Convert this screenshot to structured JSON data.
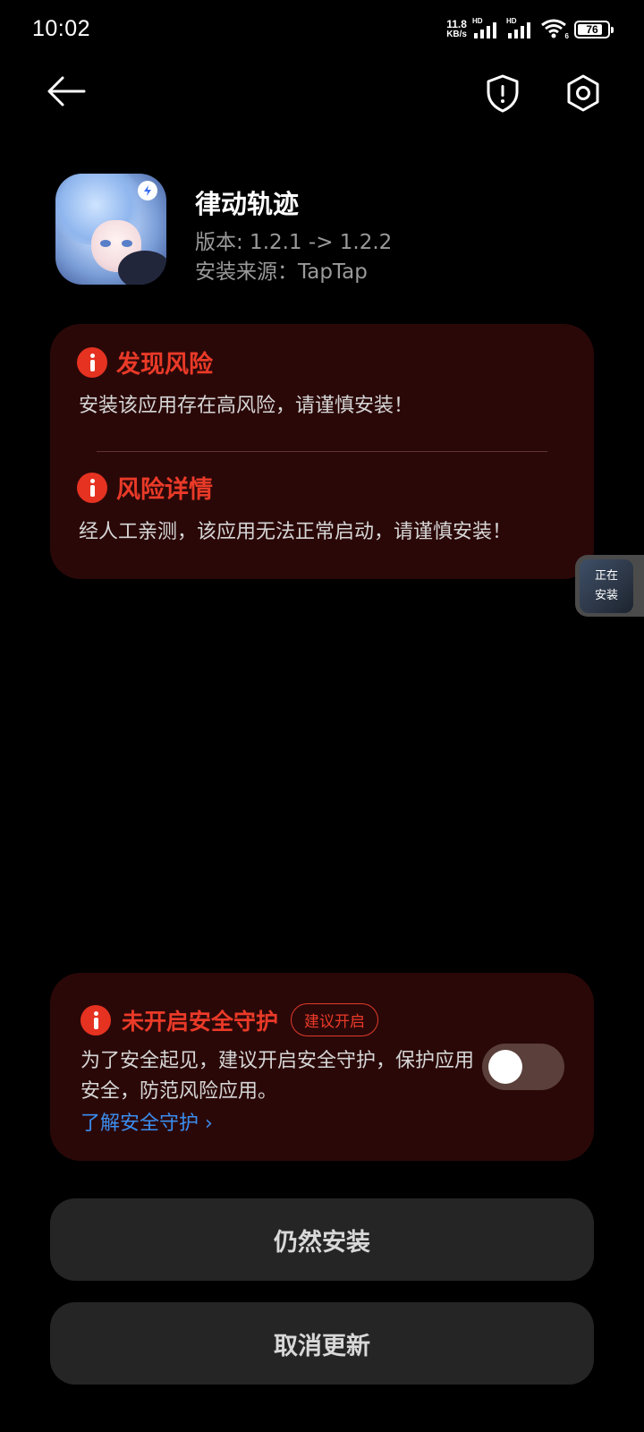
{
  "status_bar": {
    "time": "10:02",
    "net_speed_value": "11.8",
    "net_speed_unit": "KB/s",
    "sim1_label": "HD",
    "sim2_label": "HD",
    "wifi_label": "6",
    "battery": "76"
  },
  "nav": {
    "back_icon": "arrow-left-icon",
    "shield_icon": "shield-alert-icon",
    "settings_icon": "hexagon-gear-icon"
  },
  "app": {
    "name": "律动轨迹",
    "version": "版本: 1.2.1 -> 1.2.2",
    "source": "安装来源：TapTap"
  },
  "risk": {
    "found_title": "发现风险",
    "found_desc": "安装该应用存在高风险，请谨慎安装！",
    "detail_title": "风险详情",
    "detail_desc": "经人工亲测，该应用无法正常启动，请谨慎安装！"
  },
  "floating_chip": {
    "line1": "正在",
    "line2": "安装"
  },
  "protection": {
    "title": "未开启安全守护",
    "badge": "建议开启",
    "desc": "为了安全起见，建议开启安全守护，保护应用安全，防范风险应用。",
    "link": "了解安全守护 ›",
    "toggle_on": false
  },
  "buttons": {
    "install_anyway": "仍然安装",
    "cancel_update": "取消更新"
  },
  "colors": {
    "accent_red": "#ea3a28",
    "card_bg": "#2b0808",
    "link_blue": "#3a8ef0",
    "button_bg": "#252525"
  }
}
